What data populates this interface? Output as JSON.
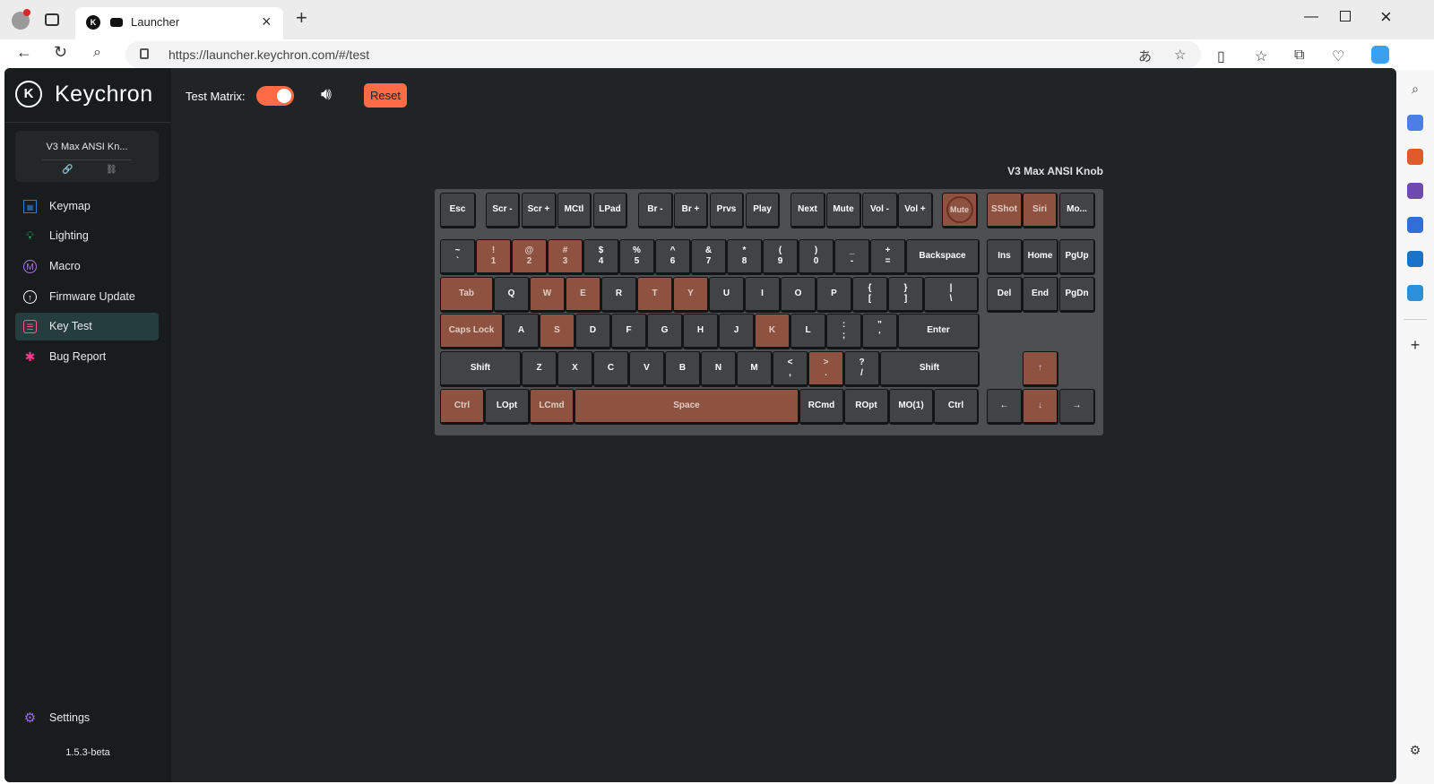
{
  "browser": {
    "tab_title": "Launcher",
    "url": "https://launcher.keychron.com/#/test",
    "colors": {
      "chrome_bg": "#ececec",
      "accent": "#ff6b45"
    }
  },
  "app": {
    "brand": "Keychron",
    "device_name": "V3 Max ANSI Kn...",
    "nav": [
      {
        "label": "Keymap",
        "icon": "keymap-icon"
      },
      {
        "label": "Lighting",
        "icon": "lightbulb-icon"
      },
      {
        "label": "Macro",
        "icon": "macro-icon"
      },
      {
        "label": "Firmware Update",
        "icon": "firmware-update-icon"
      },
      {
        "label": "Key Test",
        "icon": "key-test-icon",
        "active": true
      },
      {
        "label": "Bug Report",
        "icon": "bug-icon"
      }
    ],
    "settings_label": "Settings",
    "version": "1.5.3-beta"
  },
  "toolbar": {
    "test_matrix_label": "Test Matrix:",
    "test_matrix_on": true,
    "reset_label": "Reset"
  },
  "keyboard": {
    "title": "V3 Max ANSI Knob",
    "rows": [
      [
        {
          "label": "Esc"
        },
        {
          "label": "Scr -"
        },
        {
          "label": "Scr +"
        },
        {
          "label": "MCtl"
        },
        {
          "label": "LPad"
        },
        {
          "label": "Br -"
        },
        {
          "label": "Br +"
        },
        {
          "label": "Prvs"
        },
        {
          "label": "Play"
        },
        {
          "label": "Next"
        },
        {
          "label": "Mute"
        },
        {
          "label": "Vol -"
        },
        {
          "label": "Vol +"
        },
        {
          "label": "Mute",
          "knob": true,
          "pressed": true
        },
        {
          "label": "SShot",
          "pressed": true
        },
        {
          "label": "Siri",
          "pressed": true
        },
        {
          "label": "Mo..."
        }
      ],
      [
        {
          "top": "~",
          "bottom": "`"
        },
        {
          "top": "!",
          "bottom": "1",
          "pressed": true
        },
        {
          "top": "@",
          "bottom": "2",
          "pressed": true
        },
        {
          "top": "#",
          "bottom": "3",
          "pressed": true
        },
        {
          "top": "$",
          "bottom": "4"
        },
        {
          "top": "%",
          "bottom": "5"
        },
        {
          "top": "^",
          "bottom": "6"
        },
        {
          "top": "&",
          "bottom": "7"
        },
        {
          "top": "*",
          "bottom": "8"
        },
        {
          "top": "(",
          "bottom": "9"
        },
        {
          "top": ")",
          "bottom": "0"
        },
        {
          "top": "_",
          "bottom": "-"
        },
        {
          "top": "+",
          "bottom": "="
        },
        {
          "label": "Backspace"
        },
        {
          "label": "Ins"
        },
        {
          "label": "Home"
        },
        {
          "label": "PgUp"
        }
      ],
      [
        {
          "label": "Tab",
          "pressed": true
        },
        {
          "label": "Q"
        },
        {
          "label": "W",
          "pressed": true
        },
        {
          "label": "E",
          "pressed": true
        },
        {
          "label": "R"
        },
        {
          "label": "T",
          "pressed": true
        },
        {
          "label": "Y",
          "pressed": true
        },
        {
          "label": "U"
        },
        {
          "label": "I"
        },
        {
          "label": "O"
        },
        {
          "label": "P"
        },
        {
          "top": "{",
          "bottom": "["
        },
        {
          "top": "}",
          "bottom": "]"
        },
        {
          "top": "|",
          "bottom": "\\"
        },
        {
          "label": "Del"
        },
        {
          "label": "End"
        },
        {
          "label": "PgDn"
        }
      ],
      [
        {
          "label": "Caps Lock",
          "pressed": true
        },
        {
          "label": "A"
        },
        {
          "label": "S",
          "pressed": true
        },
        {
          "label": "D"
        },
        {
          "label": "F"
        },
        {
          "label": "G"
        },
        {
          "label": "H"
        },
        {
          "label": "J"
        },
        {
          "label": "K",
          "pressed": true
        },
        {
          "label": "L"
        },
        {
          "top": ":",
          "bottom": ";"
        },
        {
          "top": "\"",
          "bottom": "'"
        },
        {
          "label": "Enter"
        }
      ],
      [
        {
          "label": "Shift"
        },
        {
          "label": "Z"
        },
        {
          "label": "X"
        },
        {
          "label": "C"
        },
        {
          "label": "V"
        },
        {
          "label": "B"
        },
        {
          "label": "N"
        },
        {
          "label": "M"
        },
        {
          "top": "<",
          "bottom": ","
        },
        {
          "top": ">",
          "bottom": ".",
          "pressed": true
        },
        {
          "top": "?",
          "bottom": "/"
        },
        {
          "label": "Shift"
        },
        {
          "label": "↑",
          "pressed": true
        }
      ],
      [
        {
          "label": "Ctrl",
          "pressed": true
        },
        {
          "label": "LOpt"
        },
        {
          "label": "LCmd",
          "pressed": true
        },
        {
          "label": "Space",
          "pressed": true
        },
        {
          "label": "RCmd"
        },
        {
          "label": "ROpt"
        },
        {
          "label": "MO(1)"
        },
        {
          "label": "Ctrl"
        },
        {
          "label": "←"
        },
        {
          "label": "↓",
          "pressed": true
        },
        {
          "label": "→"
        }
      ]
    ]
  }
}
